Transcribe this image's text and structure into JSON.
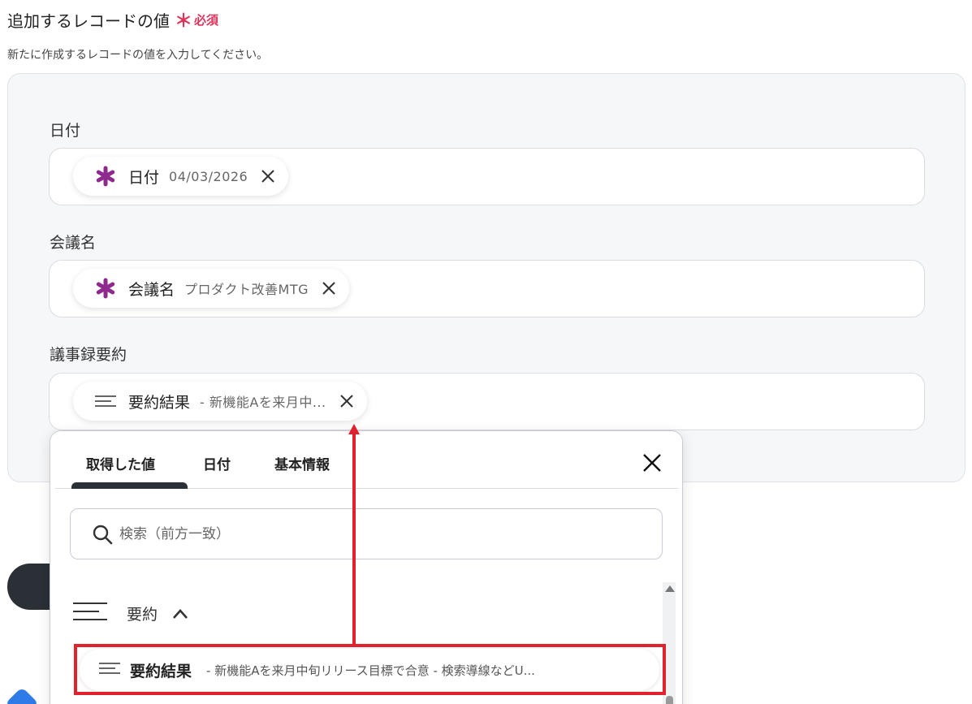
{
  "section": {
    "title": "追加するレコードの値",
    "required_mark": "＊",
    "required_label": "必須",
    "description": "新たに作成するレコードの値を入力してください。"
  },
  "fields": [
    {
      "label": "日付",
      "chip_name": "日付",
      "chip_value": "04/03/2026",
      "icon": "asterisk-icon"
    },
    {
      "label": "会議名",
      "chip_name": "会議名",
      "chip_value": "プロダクト改善MTG",
      "icon": "asterisk-icon"
    },
    {
      "label": "議事録要約",
      "chip_name": "要約結果",
      "chip_value": "- 新機能Aを来月中...",
      "icon": "text-lines-icon"
    }
  ],
  "dropdown": {
    "tabs": [
      "取得した値",
      "日付",
      "基本情報"
    ],
    "active_tab": 0,
    "search_placeholder": "検索（前方一致）",
    "group_label": "要約",
    "item_name": "要約結果",
    "item_value": "- 新機能Aを来月中旬リリース目標で合意 - 検索導線などU..."
  },
  "colors": {
    "required": "#e0335a",
    "asterisk_icon": "#8e2a8e",
    "highlight": "#e0222f",
    "panel_bg": "#f6f7f9",
    "dark": "#2b2f36"
  }
}
